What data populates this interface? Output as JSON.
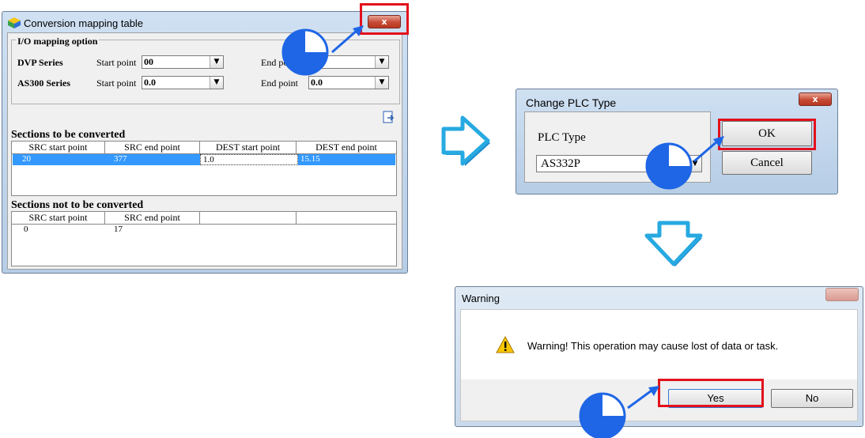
{
  "conversion_window": {
    "title": "Conversion mapping table",
    "close_label": "x",
    "io_group_title": "I/O mapping option",
    "rows": [
      {
        "series": "DVP Series",
        "start_label": "Start point",
        "start_value": "00",
        "end_label": "End point",
        "end_value": ""
      },
      {
        "series": "AS300 Series",
        "start_label": "Start point",
        "start_value": "0.0",
        "end_label": "End point",
        "end_value": "0.0"
      }
    ],
    "converted_title": "Sections to be converted",
    "converted_headers": [
      "SRC start point",
      "SRC end point",
      "DEST start point",
      "DEST end point"
    ],
    "converted_row": [
      "20",
      "377",
      "1.0",
      "15.15"
    ],
    "not_converted_title": "Sections not to be converted",
    "not_converted_headers": [
      "SRC start point",
      "SRC end point",
      "",
      ""
    ],
    "not_converted_row": [
      "0",
      "17"
    ]
  },
  "change_plc_window": {
    "title": "Change PLC Type",
    "close_label": "x",
    "plc_type_label": "PLC Type",
    "plc_type_value": "AS332P",
    "ok_label": "OK",
    "cancel_label": "Cancel"
  },
  "warning_window": {
    "title": "Warning",
    "message": "Warning! This operation may cause lost of data or task.",
    "yes_label": "Yes",
    "no_label": "No"
  },
  "colors": {
    "highlight_red": "#e3111b",
    "flow_arrow": "#27a9e1",
    "callout_blue": "#1f66e6",
    "selection_blue": "#3399ff"
  }
}
